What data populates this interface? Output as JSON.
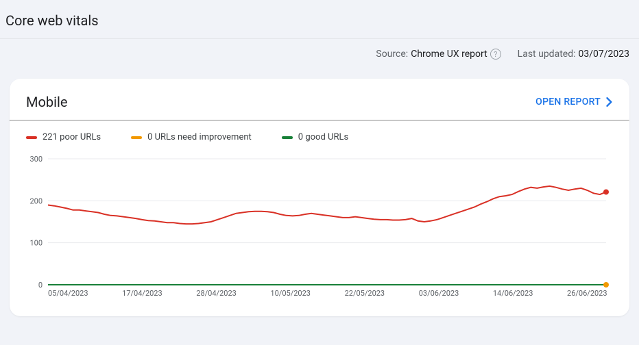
{
  "page": {
    "title": "Core web vitals",
    "source_label": "Source:",
    "source_value": "Chrome UX report",
    "last_updated_label": "Last updated:",
    "last_updated_value": "03/07/2023"
  },
  "card": {
    "title": "Mobile",
    "open_report_label": "OPEN REPORT"
  },
  "legend": {
    "poor": "221 poor URLs",
    "need": "0 URLs need improvement",
    "good": "0 good URLs"
  },
  "colors": {
    "poor": "#d93025",
    "need": "#f29900",
    "good": "#188038",
    "link": "#1a73e8"
  },
  "chart_data": {
    "type": "line",
    "title": "",
    "xlabel": "",
    "ylabel": "",
    "ylim": [
      0,
      300
    ],
    "y_ticks": [
      0,
      100,
      200,
      300
    ],
    "x_tick_labels": [
      "05/04/2023",
      "17/04/2023",
      "28/04/2023",
      "10/05/2023",
      "22/05/2023",
      "03/06/2023",
      "14/06/2023",
      "26/06/2023"
    ],
    "x": [
      0,
      1,
      2,
      3,
      4,
      5,
      6,
      7,
      8,
      9,
      10,
      11,
      12,
      13,
      14,
      15,
      16,
      17,
      18,
      19,
      20,
      21,
      22,
      23,
      24,
      25,
      26,
      27,
      28,
      29,
      30,
      31,
      32,
      33,
      34,
      35,
      36,
      37,
      38,
      39,
      40,
      41,
      42,
      43,
      44,
      45,
      46,
      47,
      48,
      49,
      50,
      51,
      52,
      53,
      54,
      55,
      56,
      57,
      58,
      59,
      60,
      61,
      62,
      63,
      64,
      65,
      66,
      67,
      68,
      69,
      70,
      71,
      72,
      73,
      74,
      75,
      76,
      77,
      78,
      79,
      80,
      81,
      82,
      83,
      84,
      85,
      86,
      87,
      88,
      89
    ],
    "series": [
      {
        "name": "221 poor URLs",
        "color": "#d93025",
        "values": [
          190,
          188,
          185,
          182,
          178,
          178,
          176,
          174,
          172,
          168,
          165,
          164,
          162,
          160,
          158,
          155,
          153,
          152,
          150,
          148,
          148,
          146,
          145,
          145,
          146,
          148,
          150,
          155,
          160,
          165,
          170,
          172,
          174,
          175,
          175,
          174,
          172,
          168,
          165,
          164,
          165,
          168,
          170,
          168,
          166,
          164,
          162,
          160,
          160,
          162,
          160,
          158,
          156,
          155,
          155,
          154,
          154,
          155,
          158,
          152,
          150,
          152,
          155,
          160,
          165,
          170,
          175,
          180,
          185,
          192,
          198,
          205,
          210,
          212,
          215,
          222,
          228,
          232,
          230,
          233,
          235,
          232,
          228,
          225,
          228,
          230,
          225,
          218,
          215,
          221
        ]
      },
      {
        "name": "0 URLs need improvement",
        "color": "#f29900",
        "values": [
          0,
          0,
          0,
          0,
          0,
          0,
          0,
          0,
          0,
          0,
          0,
          0,
          0,
          0,
          0,
          0,
          0,
          0,
          0,
          0,
          0,
          0,
          0,
          0,
          0,
          0,
          0,
          0,
          0,
          0,
          0,
          0,
          0,
          0,
          0,
          0,
          0,
          0,
          0,
          0,
          0,
          0,
          0,
          0,
          0,
          0,
          0,
          0,
          0,
          0,
          0,
          0,
          0,
          0,
          0,
          0,
          0,
          0,
          0,
          0,
          0,
          0,
          0,
          0,
          0,
          0,
          0,
          0,
          0,
          0,
          0,
          0,
          0,
          0,
          0,
          0,
          0,
          0,
          0,
          0,
          0,
          0,
          0,
          0,
          0,
          0,
          0,
          0,
          0,
          0
        ]
      },
      {
        "name": "0 good URLs",
        "color": "#188038",
        "values": [
          0,
          0,
          0,
          0,
          0,
          0,
          0,
          0,
          0,
          0,
          0,
          0,
          0,
          0,
          0,
          0,
          0,
          0,
          0,
          0,
          0,
          0,
          0,
          0,
          0,
          0,
          0,
          0,
          0,
          0,
          0,
          0,
          0,
          0,
          0,
          0,
          0,
          0,
          0,
          0,
          0,
          0,
          0,
          0,
          0,
          0,
          0,
          0,
          0,
          0,
          0,
          0,
          0,
          0,
          0,
          0,
          0,
          0,
          0,
          0,
          0,
          0,
          0,
          0,
          0,
          0,
          0,
          0,
          0,
          0,
          0,
          0,
          0,
          0,
          0,
          0,
          0,
          0,
          0,
          0,
          0,
          0,
          0,
          0,
          0,
          0,
          0,
          0,
          0,
          0
        ]
      }
    ]
  }
}
